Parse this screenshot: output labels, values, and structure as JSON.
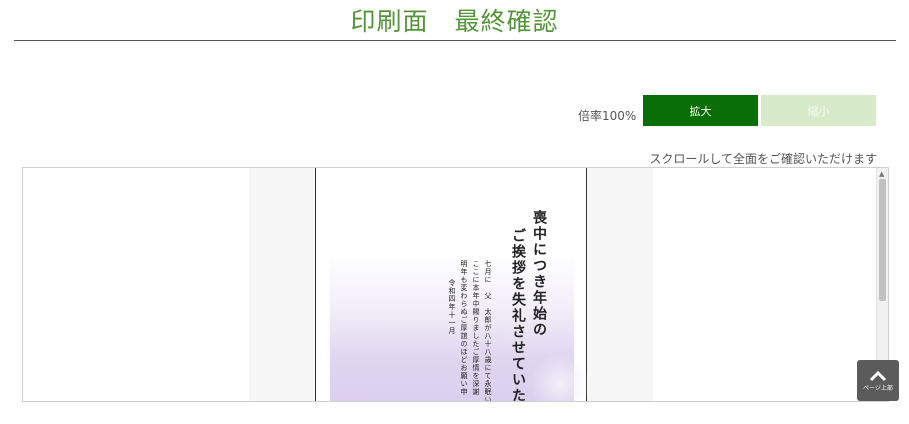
{
  "header": {
    "title": "印刷面　最終確認"
  },
  "zoom": {
    "label": "倍率100%",
    "zoom_in": "拡大",
    "zoom_out": "縮小"
  },
  "viewer": {
    "hint": "スクロールして全面をご確認いただけます",
    "card": {
      "heading": [
        "喪中につき年始の",
        "ご挨拶を失礼させていた"
      ],
      "body": [
        "七月に　父　太郎が八十八歳にて永眠い",
        "ここに本年中賜りましたご厚情を深謝",
        "明年も変わらぬご厚誼のほどお願い申",
        "令和四年十一月"
      ]
    }
  },
  "page_top": {
    "label": "ページ上部"
  },
  "colors": {
    "title": "#55953a",
    "zoom_in_bg": "#0a6e06",
    "zoom_out_bg": "#d8ebc9",
    "page_top_bg": "#5b5b5b"
  }
}
